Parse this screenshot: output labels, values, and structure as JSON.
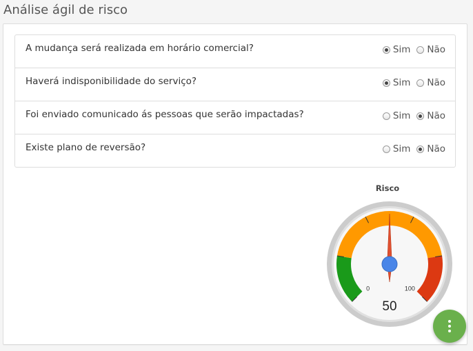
{
  "page": {
    "title": "Análise ágil de risco"
  },
  "questions": [
    {
      "text": "A mudança será realizada em horário comercial?",
      "yes_label": "Sim",
      "no_label": "Não",
      "selected": "yes"
    },
    {
      "text": "Haverá indisponibilidade do serviço?",
      "yes_label": "Sim",
      "no_label": "Não",
      "selected": "yes"
    },
    {
      "text": "Foi enviado comunicado ás pessoas que serão impactadas?",
      "yes_label": "Sim",
      "no_label": "Não",
      "selected": "no"
    },
    {
      "text": "Existe plano de reversão?",
      "yes_label": "Sim",
      "no_label": "Não",
      "selected": "no"
    }
  ],
  "gauge": {
    "title": "Risco",
    "value": 50,
    "value_text": "50",
    "min": 0,
    "max": 100,
    "min_label": "0",
    "max_label": "100",
    "bands": [
      {
        "from": 0,
        "to": 20,
        "color": "#1a9a1a"
      },
      {
        "from": 20,
        "to": 80,
        "color": "#ff9900"
      },
      {
        "from": 80,
        "to": 100,
        "color": "#dc3912"
      }
    ],
    "needle_color": "#e05030",
    "hub_color": "#4a86e8"
  },
  "fab": {
    "icon": "more-vertical-icon",
    "color": "#6ab04c"
  }
}
